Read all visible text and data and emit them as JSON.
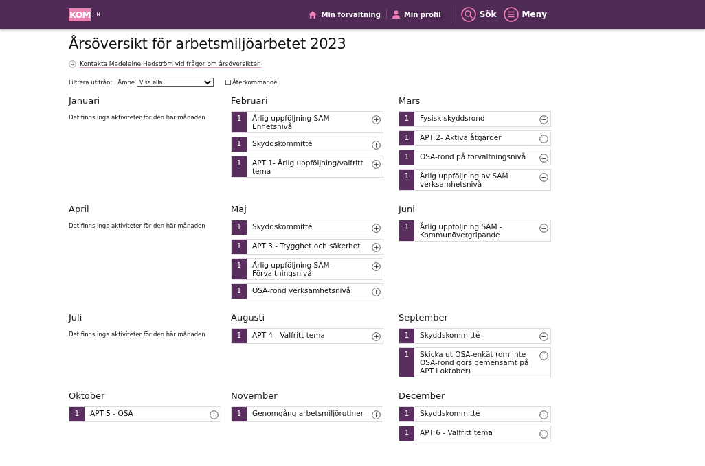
{
  "header": {
    "logo": {
      "main": "KOM",
      "suffix": "IN"
    },
    "nav": [
      {
        "kind": "home",
        "label": "Min förvaltning"
      },
      {
        "kind": "user",
        "label": "Min profil"
      }
    ],
    "actions": [
      {
        "kind": "search",
        "label": "Sök"
      },
      {
        "kind": "menu",
        "label": "Meny"
      }
    ]
  },
  "title": "Årsöversikt för arbetsmiljöarbetet 2023",
  "contact_link": "Kontakta Madeleine Hedström vid frågor om årsöversikten",
  "filter": {
    "label": "Filtrera utifrån:",
    "subject_label": "Ämne",
    "subject_value": "Visa alla",
    "recurring_label": "Återkommande",
    "recurring_checked": false
  },
  "months": [
    {
      "name": "Januari",
      "empty_text": "Det finns inga aktiviteter för den här månaden"
    },
    {
      "name": "Februari",
      "items": [
        {
          "count": "1",
          "title": "Årlig uppföljning SAM - Enhetsnivå"
        },
        {
          "count": "1",
          "title": "Skyddskommitté"
        },
        {
          "count": "1",
          "title": "APT 1- Årlig uppföljning/valfritt tema"
        }
      ]
    },
    {
      "name": "Mars",
      "items": [
        {
          "count": "1",
          "title": "Fysisk skyddsrond"
        },
        {
          "count": "1",
          "title": "APT 2- Aktiva åtgärder"
        },
        {
          "count": "1",
          "title": "OSA-rond på förvaltningsnivå"
        },
        {
          "count": "1",
          "title": "Årlig uppföljning av SAM verksamhetsnivå"
        }
      ]
    },
    {
      "name": "April",
      "empty_text": "Det finns inga aktiviteter för den här månaden"
    },
    {
      "name": "Maj",
      "items": [
        {
          "count": "1",
          "title": "Skyddskommitté"
        },
        {
          "count": "1",
          "title": "APT 3 - Trygghet och säkerhet"
        },
        {
          "count": "1",
          "title": "Årlig uppföljning SAM - Förvaltningsnivå"
        },
        {
          "count": "1",
          "title": "OSA-rond verksamhetsnivå"
        }
      ]
    },
    {
      "name": "Juni",
      "items": [
        {
          "count": "1",
          "title": "Årlig uppföljning SAM - Kommunövergripande"
        }
      ]
    },
    {
      "name": "Juli",
      "empty_text": "Det finns inga aktiviteter för den här månaden"
    },
    {
      "name": "Augusti",
      "items": [
        {
          "count": "1",
          "title": "APT 4 - Valfritt tema"
        }
      ]
    },
    {
      "name": "September",
      "items": [
        {
          "count": "1",
          "title": "Skyddskommitté"
        },
        {
          "count": "1",
          "title": "Skicka ut OSA-enkät (om inte OSA-rond görs gemensamt på APT i oktober)"
        }
      ]
    },
    {
      "name": "Oktober",
      "items": [
        {
          "count": "1",
          "title": "APT 5 - OSA"
        }
      ]
    },
    {
      "name": "November",
      "items": [
        {
          "count": "1",
          "title": "Genomgång arbetsmiljörutiner"
        }
      ]
    },
    {
      "name": "December",
      "items": [
        {
          "count": "1",
          "title": "Skyddskommitté"
        },
        {
          "count": "1",
          "title": "APT 6 - Valfritt tema"
        }
      ]
    }
  ]
}
